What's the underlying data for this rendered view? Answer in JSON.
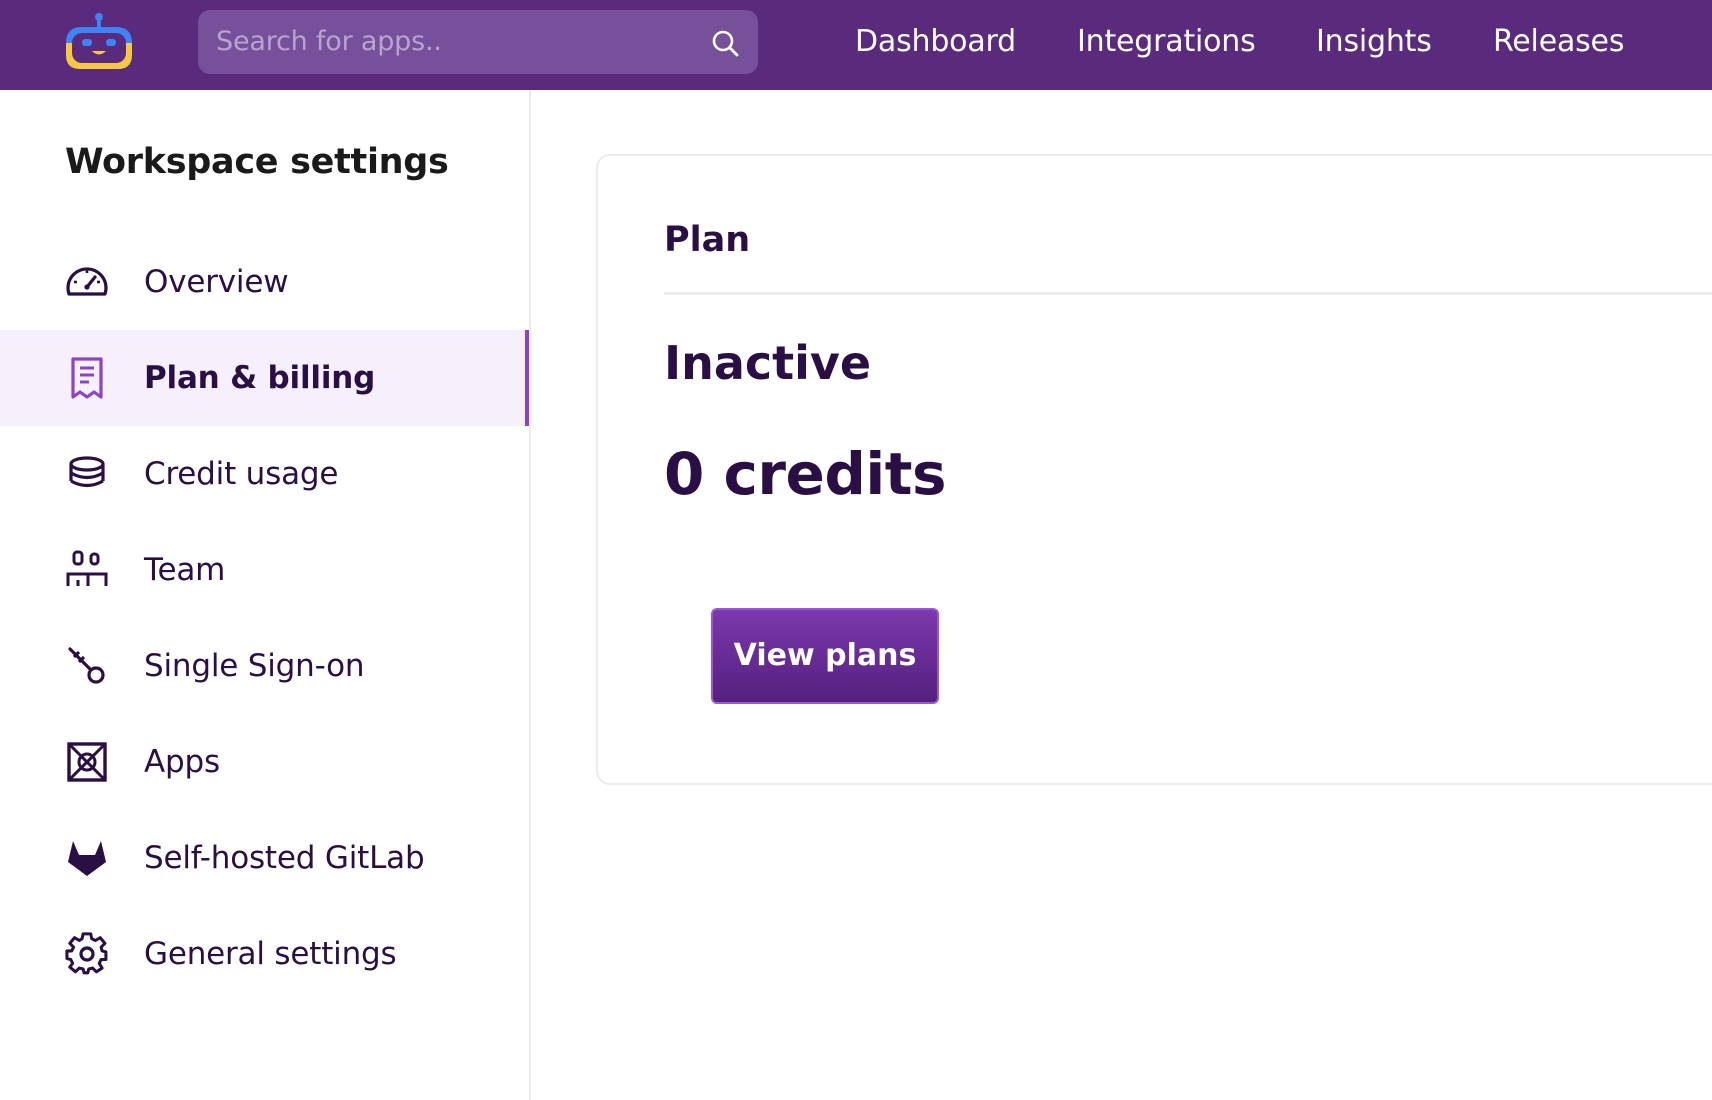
{
  "header": {
    "logo_icon": "robot-logo-icon",
    "search": {
      "placeholder": "Search for apps..",
      "icon": "search-icon"
    },
    "nav": [
      {
        "label": "Dashboard"
      },
      {
        "label": "Integrations"
      },
      {
        "label": "Insights"
      },
      {
        "label": "Releases"
      }
    ],
    "colors": {
      "bar": "#5a2a7d",
      "search_bg": "#76509a"
    }
  },
  "sidebar": {
    "title": "Workspace settings",
    "active_index": 1,
    "items": [
      {
        "label": "Overview",
        "icon": "speedometer-icon"
      },
      {
        "label": "Plan & billing",
        "icon": "receipt-icon"
      },
      {
        "label": "Credit usage",
        "icon": "coins-stack-icon"
      },
      {
        "label": "Team",
        "icon": "team-icon"
      },
      {
        "label": "Single Sign-on",
        "icon": "key-icon"
      },
      {
        "label": "Apps",
        "icon": "apps-box-icon"
      },
      {
        "label": "Self-hosted GitLab",
        "icon": "gitlab-icon"
      },
      {
        "label": "General settings",
        "icon": "gear-icon"
      }
    ]
  },
  "plan_card": {
    "title": "Plan",
    "status": "Inactive",
    "credits": "0 credits",
    "button_label": "View plans"
  },
  "colors": {
    "accent": "#8a44c8",
    "text_dark": "#2a0f45",
    "active_bg": "#f6effc"
  }
}
